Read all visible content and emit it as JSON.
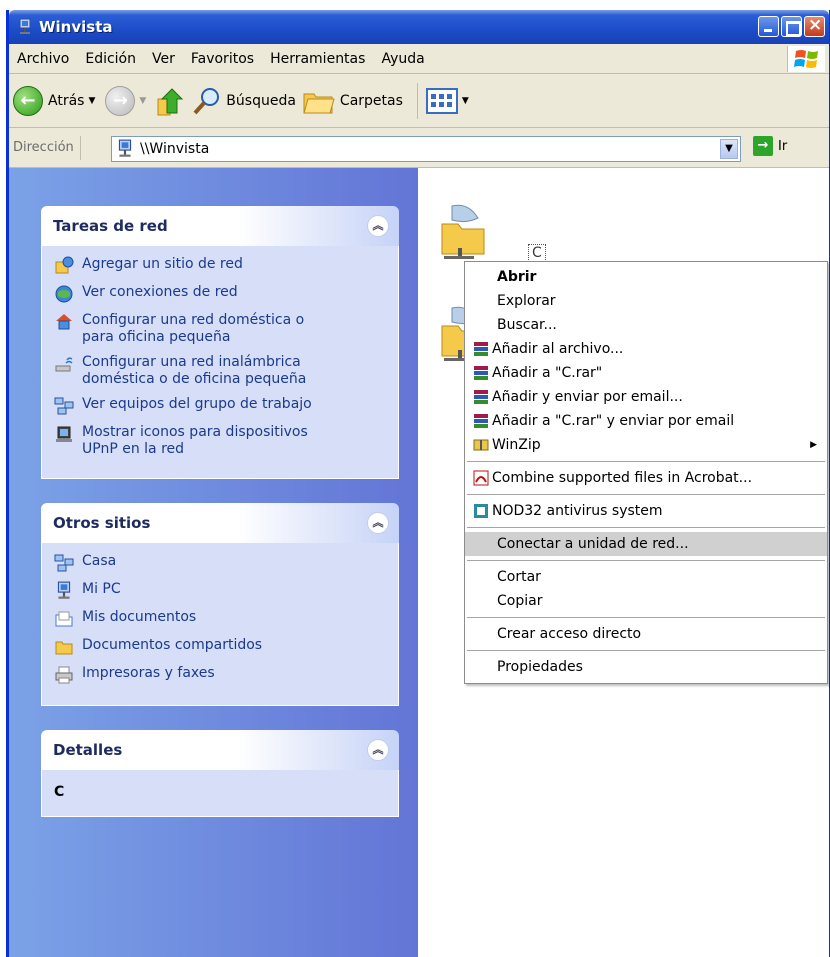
{
  "window": {
    "title": "Winvista"
  },
  "menubar": {
    "items": [
      "Archivo",
      "Edición",
      "Ver",
      "Favoritos",
      "Herramientas",
      "Ayuda"
    ]
  },
  "toolbar": {
    "back_label": "Atrás",
    "search_label": "Búsqueda",
    "folders_label": "Carpetas"
  },
  "address": {
    "label": "Dirección",
    "value": "\\\\Winvista",
    "go_label": "Ir"
  },
  "panels": {
    "network_tasks": {
      "title": "Tareas de red",
      "items": [
        "Agregar un sitio de red",
        "Ver conexiones de red",
        "Configurar una red doméstica o\npara oficina pequeña",
        "Configurar una red inalámbrica\ndoméstica o de oficina pequeña",
        "Ver equipos del grupo de trabajo",
        "Mostrar iconos para dispositivos\nUPnP en la red"
      ]
    },
    "other_places": {
      "title": "Otros sitios",
      "items": [
        "Casa",
        "Mi PC",
        "Mis documentos",
        "Documentos compartidos",
        "Impresoras y faxes"
      ]
    },
    "details": {
      "title": "Detalles",
      "name": "C"
    }
  },
  "content": {
    "share_label": "C"
  },
  "context_menu": {
    "items": [
      "Abrir",
      "Explorar",
      "Buscar...",
      "Añadir al archivo...",
      "Añadir a \"C.rar\"",
      "Añadir y enviar por email...",
      "Añadir a \"C.rar\" y enviar por email",
      "WinZip",
      "Combine supported files in Acrobat...",
      "NOD32 antivirus system",
      "Conectar a unidad de red...",
      "Cortar",
      "Copiar",
      "Crear acceso directo",
      "Propiedades"
    ]
  },
  "colors": {
    "titlebar": "#1c4cc8",
    "sidebar": "#7ba2e7",
    "highlight": "#d0d0d0"
  }
}
